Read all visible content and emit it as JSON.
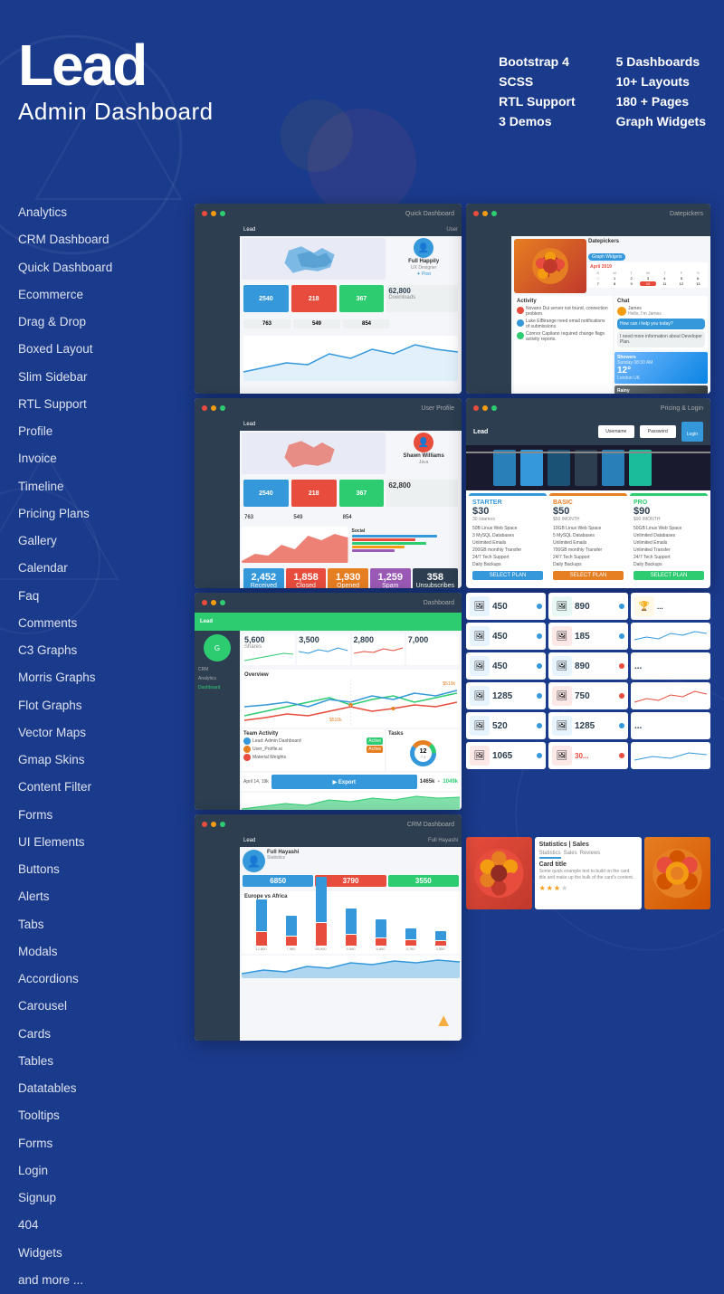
{
  "brand": {
    "lead": "Lead",
    "subtitle": "Admin Dashboard"
  },
  "features": {
    "col1": [
      {
        "label": "Bootstrap 4"
      },
      {
        "label": "SCSS"
      },
      {
        "label": "RTL Support"
      },
      {
        "label": "3  Demos"
      }
    ],
    "col2": [
      {
        "label": "5 Dashboards"
      },
      {
        "label": "10+ Layouts"
      },
      {
        "label": "180 + Pages"
      },
      {
        "label": "Graph Widgets"
      }
    ]
  },
  "nav": {
    "items": [
      "Analytics",
      "CRM Dashboard",
      "Quick Dashboard",
      "Ecommerce",
      "Drag & Drop",
      "Boxed Layout",
      "Slim Sidebar",
      "RTL Support",
      "Profile",
      "Invoice",
      "Timeline",
      "Pricing Plans",
      "Gallery",
      "Calendar",
      "Faq",
      "Comments",
      "C3 Graphs",
      "Morris Graphs",
      "Flot Graphs",
      "Vector Maps",
      "Gmap Skins",
      "Content Filter",
      "Forms",
      "UI Elements",
      "Buttons",
      "Alerts",
      "Tabs",
      "Modals",
      "Accordions",
      "Carousel",
      "Cards",
      "Tables",
      "Datatables",
      "Tooltips",
      "Forms",
      "Login",
      "Signup",
      "404",
      "Widgets",
      "and more ..."
    ]
  },
  "mockups": {
    "stats": [
      {
        "value": "2540",
        "color": "#3498db"
      },
      {
        "value": "218",
        "color": "#e74c3c"
      },
      {
        "value": "367",
        "color": "#2ecc71"
      },
      {
        "value": "62,800",
        "label": "Downloads"
      },
      {
        "value": "763"
      },
      {
        "value": "549"
      },
      {
        "value": "854"
      }
    ],
    "emails": [
      {
        "label": "Received",
        "value": "2,452",
        "color": "#3498db"
      },
      {
        "label": "Closed",
        "value": "1,858",
        "color": "#e74c3c"
      },
      {
        "label": "Opened",
        "value": "1,930",
        "color": "#e67e22"
      },
      {
        "label": "Spam",
        "value": "1,259",
        "color": "#9b59b6"
      },
      {
        "label": "Unsubscribes",
        "value": "358",
        "color": "#2c3e50"
      }
    ],
    "dashStats": [
      {
        "value": "5,600",
        "label": "Shares"
      },
      {
        "value": "3,500",
        "label": ""
      },
      {
        "value": "2,800",
        "label": ""
      },
      {
        "value": "7,000",
        "label": ""
      }
    ],
    "pricing": [
      {
        "name": "STARTER",
        "price": "$30",
        "period": "30 /starters",
        "features": [
          "50B Linux Web Space",
          "3 MySQL Databases",
          "Unlimited Emails",
          "200GB monthly Transfer",
          "24/7 Tech Support",
          "Daily Backups"
        ],
        "color": "#3498db"
      },
      {
        "name": "BASIC",
        "price": "$50",
        "period": "$50 /MONTH",
        "features": [
          "10GB Linux Web Space",
          "5 MySQL Databases",
          "Unlimited Emails",
          "700GB monthly Transfer",
          "24/7 Tech Support",
          "Daily Backups"
        ],
        "color": "#e67e22"
      }
    ],
    "numCards": [
      {
        "val": "450",
        "icon": "♦",
        "color": "#3498db"
      },
      {
        "val": "890",
        "icon": "♦",
        "color": "#3498db"
      },
      {
        "val": "450",
        "icon": "♦",
        "color": "#3498db"
      },
      {
        "val": "185",
        "icon": "♦",
        "color": "#3498db"
      },
      {
        "val": "450",
        "icon": "♦",
        "color": "#3498db"
      },
      {
        "val": "890",
        "icon": "♦",
        "color": "#e74c3c"
      },
      {
        "val": "1285",
        "icon": "♦",
        "color": "#3498db"
      },
      {
        "val": "750",
        "icon": "♦",
        "color": "#e74c3c"
      },
      {
        "val": "520",
        "icon": "♦",
        "color": "#3498db"
      },
      {
        "val": "1285",
        "icon": "♦",
        "color": "#3498db"
      },
      {
        "val": "1065",
        "icon": "♦",
        "color": "#3498db"
      },
      {
        "val": "30",
        "icon": "♦",
        "color": "#e74c3c"
      }
    ],
    "crmBars": [
      12800,
      7985,
      65900,
      9540,
      6850,
      3790,
      3550
    ],
    "crmLabels": [
      "12,800",
      "7,985",
      "65,900",
      "9,540",
      "6,850",
      "3,790",
      "3,550"
    ]
  },
  "colors": {
    "bg": "#1a3a8c",
    "blue": "#3498db",
    "red": "#e74c3c",
    "green": "#2ecc71",
    "orange": "#e67e22",
    "dark": "#2c3e50"
  }
}
